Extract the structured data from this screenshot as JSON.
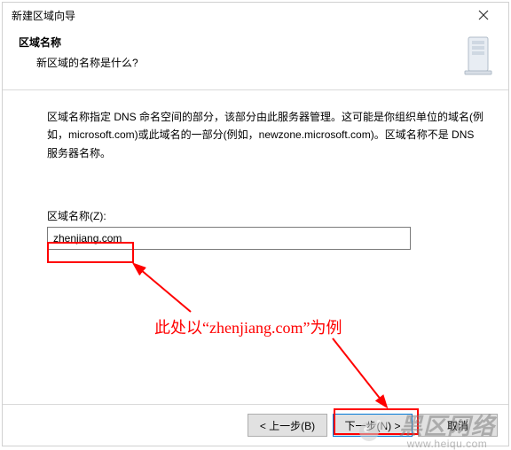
{
  "window": {
    "title": "新建区域向导",
    "close_tooltip": "关闭"
  },
  "header": {
    "heading": "区域名称",
    "subheading": "新区域的名称是什么?"
  },
  "description": "区域名称指定 DNS 命名空间的部分，该部分由此服务器管理。这可能是你组织单位的域名(例如，microsoft.com)或此域名的一部分(例如，newzone.microsoft.com)。区域名称不是 DNS 服务器名称。",
  "field": {
    "label": "区域名称(Z):",
    "value": "zhenjiang.com"
  },
  "annotation": {
    "text": "此处以“zhenjiang.com”为例"
  },
  "buttons": {
    "back": "< 上一步(B)",
    "next": "下一步(N) >",
    "cancel": "取消"
  },
  "watermark": {
    "cn": "黑区网络",
    "url": "www.heiqu.com"
  }
}
